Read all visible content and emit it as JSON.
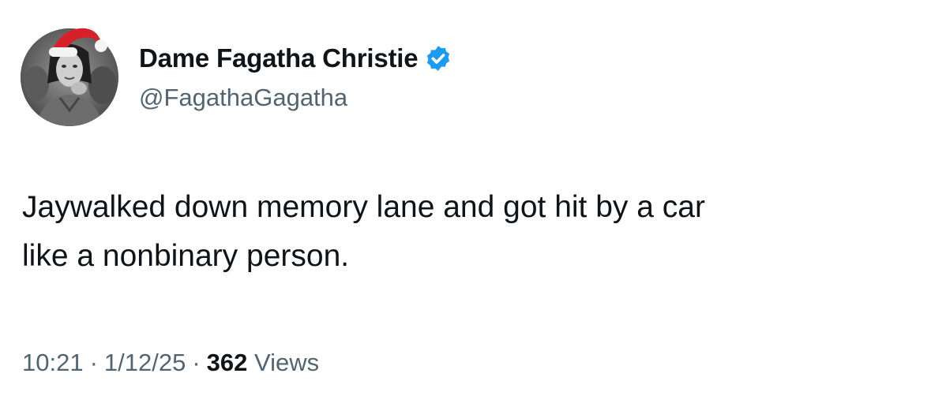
{
  "author": {
    "display_name": "Dame Fagatha Christie",
    "handle": "@FagathaGagatha",
    "verified": true,
    "avatar_icon": "profile-photo-with-santa-hat",
    "verified_color": "#1d9bf0"
  },
  "tweet": {
    "text": "Jaywalked down memory lane and got hit by a car\nlike a nonbinary person."
  },
  "meta": {
    "time": "10:21",
    "separator": "·",
    "date": "1/12/25",
    "views_count": "362",
    "views_label": "Views"
  },
  "colors": {
    "text_primary": "#0f1419",
    "text_secondary": "#536471",
    "background": "#ffffff"
  }
}
